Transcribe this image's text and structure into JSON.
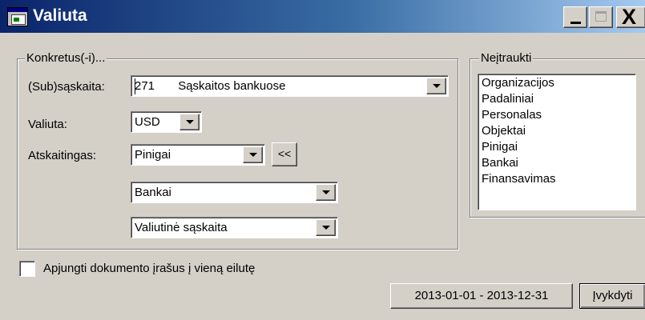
{
  "window": {
    "title": "Valiuta",
    "icon": "app-window-icon",
    "controls": {
      "minimize": "minimize-icon",
      "maximize": "maximize-icon",
      "close": "close-icon",
      "close_glyph": "X"
    }
  },
  "specific_group": {
    "label": "Konkretus(-i)...",
    "account_label": "(Sub)sąskaita:",
    "account_value": "271       Sąskaitos bankuose",
    "currency_label": "Valiuta:",
    "currency_value": "USD",
    "accountable_label": "Atskaitingas:",
    "accountable_value": "Pinigai",
    "back_button": "<<",
    "combo2_value": "Bankai",
    "combo3_value": "Valiutinė sąskaita"
  },
  "exclude_group": {
    "label": "Neįtraukti",
    "items": [
      "Organizacijos",
      "Padaliniai",
      "Personalas",
      "Objektai",
      "Pinigai",
      "Bankai",
      "Finansavimas"
    ]
  },
  "merge_checkbox": {
    "label": "Apjungti dokumento įrašus į vieną eilutę",
    "checked": false
  },
  "footer": {
    "period_button": "2013-01-01 - 2013-12-31",
    "run_button": "Įvykdyti"
  },
  "colors": {
    "titlebar_start": "#0a246a",
    "titlebar_end": "#a6caf0",
    "face": "#d4d0c8"
  }
}
